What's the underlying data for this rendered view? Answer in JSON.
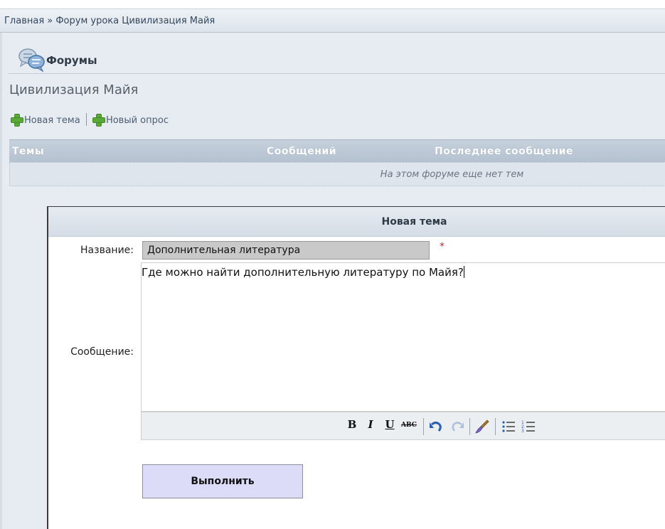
{
  "breadcrumb": "Главная » Форум урока Цивилизация Майя",
  "forums": {
    "title": "Форумы"
  },
  "forum": {
    "name": "Цивилизация Майя",
    "actions": {
      "new_topic": "Новая тема",
      "new_poll": "Новый опрос"
    },
    "table": {
      "columns": [
        "Темы",
        "Сообщений",
        "Последнее сообщение"
      ],
      "empty_text": "На этом форуме еще нет тем"
    }
  },
  "dialog": {
    "title": "Новая тема",
    "name_label": "Название:",
    "name_value": "Дополнительная литература",
    "required_mark": "*",
    "message_label": "Сообщение:",
    "message_text": "Где можно найти дополнительную литературу по Майя?",
    "toolbar": {
      "bold": "B",
      "italic": "I",
      "underline": "U",
      "strikethrough": "ABC",
      "undo": "undo-icon",
      "redo": "redo-icon",
      "cleanup": "brush-icon",
      "bullet_list": "bullet-list-icon",
      "numbered_list": "numbered-list-icon"
    },
    "submit_label": "Выполнить"
  },
  "colors": {
    "panel_bg": "#e7ecf2",
    "header_bg": "#b4c1cf",
    "button_bg": "#dcdcf8",
    "required": "#e02020",
    "plus_icon": "#5aa83a"
  }
}
